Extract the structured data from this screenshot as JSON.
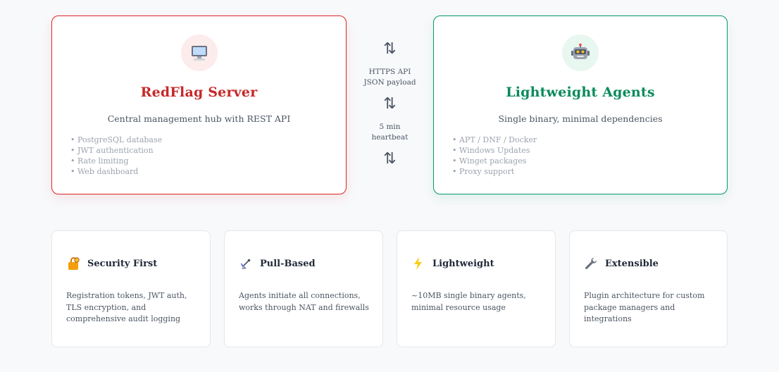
{
  "server": {
    "title": "RedFlag Server",
    "subtitle": "Central management hub with REST API",
    "features": [
      "PostgreSQL database",
      "JWT authentication",
      "Rate limiting",
      "Web dashboard"
    ],
    "icon": "computer-icon",
    "accent": "#dc2626"
  },
  "agents": {
    "title": "Lightweight Agents",
    "subtitle": "Single binary, minimal dependencies",
    "features": [
      "APT / DNF / Docker",
      "Windows Updates",
      "Winget packages",
      "Proxy support"
    ],
    "icon": "robot-icon",
    "accent": "#059669"
  },
  "connection": {
    "label1_line1": "HTTPS API",
    "label1_line2": "JSON payload",
    "label2_line1": "5 min",
    "label2_line2": "heartbeat",
    "arrow": "⇅"
  },
  "highlights": [
    {
      "icon": "lock-icon",
      "title": "Security First",
      "desc": "Registration tokens, JWT auth, TLS encryption, and comprehensive audit logging"
    },
    {
      "icon": "satellite-dish-icon",
      "title": "Pull-Based",
      "desc": "Agents initiate all connections, works through NAT and firewalls"
    },
    {
      "icon": "lightning-icon",
      "title": "Lightweight",
      "desc": "~10MB single binary agents, minimal resource usage"
    },
    {
      "icon": "wrench-icon",
      "title": "Extensible",
      "desc": "Plugin architecture for custom package managers and integrations"
    }
  ]
}
